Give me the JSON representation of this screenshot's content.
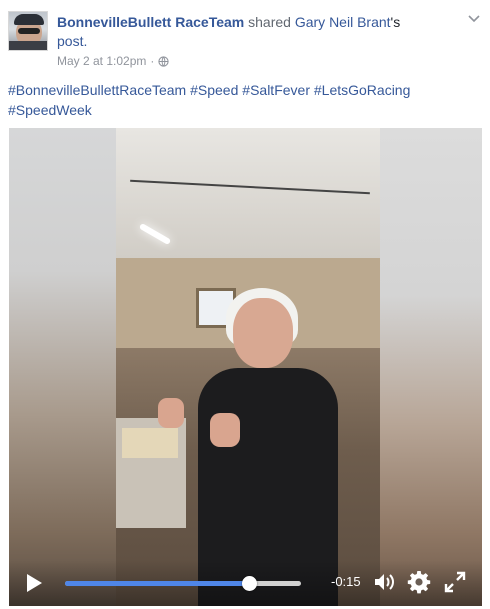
{
  "post": {
    "page_name": "BonnevilleBullett RaceTeam",
    "shared_text": " shared ",
    "original_author": "Gary Neil Brant",
    "possessive": "'s",
    "post_word": "post.",
    "timestamp": "May 2 at 1:02pm",
    "separator": "·",
    "privacy_icon": "globe-icon",
    "menu_icon": "chevron-down-icon"
  },
  "hashtags": [
    "#BonnevilleBullettRaceTeam",
    "#Speed",
    "#SaltFever",
    "#LetsGoRacing",
    "#SpeedWeek"
  ],
  "video": {
    "remaining_time": "-0:15",
    "progress": 0.78,
    "icons": [
      "play-icon",
      "volume-icon",
      "gear-icon",
      "fullscreen-icon"
    ],
    "accent_color": "#4f86e8"
  },
  "colors": {
    "link": "#365899",
    "text": "#1d2129",
    "meta": "#90949c"
  }
}
